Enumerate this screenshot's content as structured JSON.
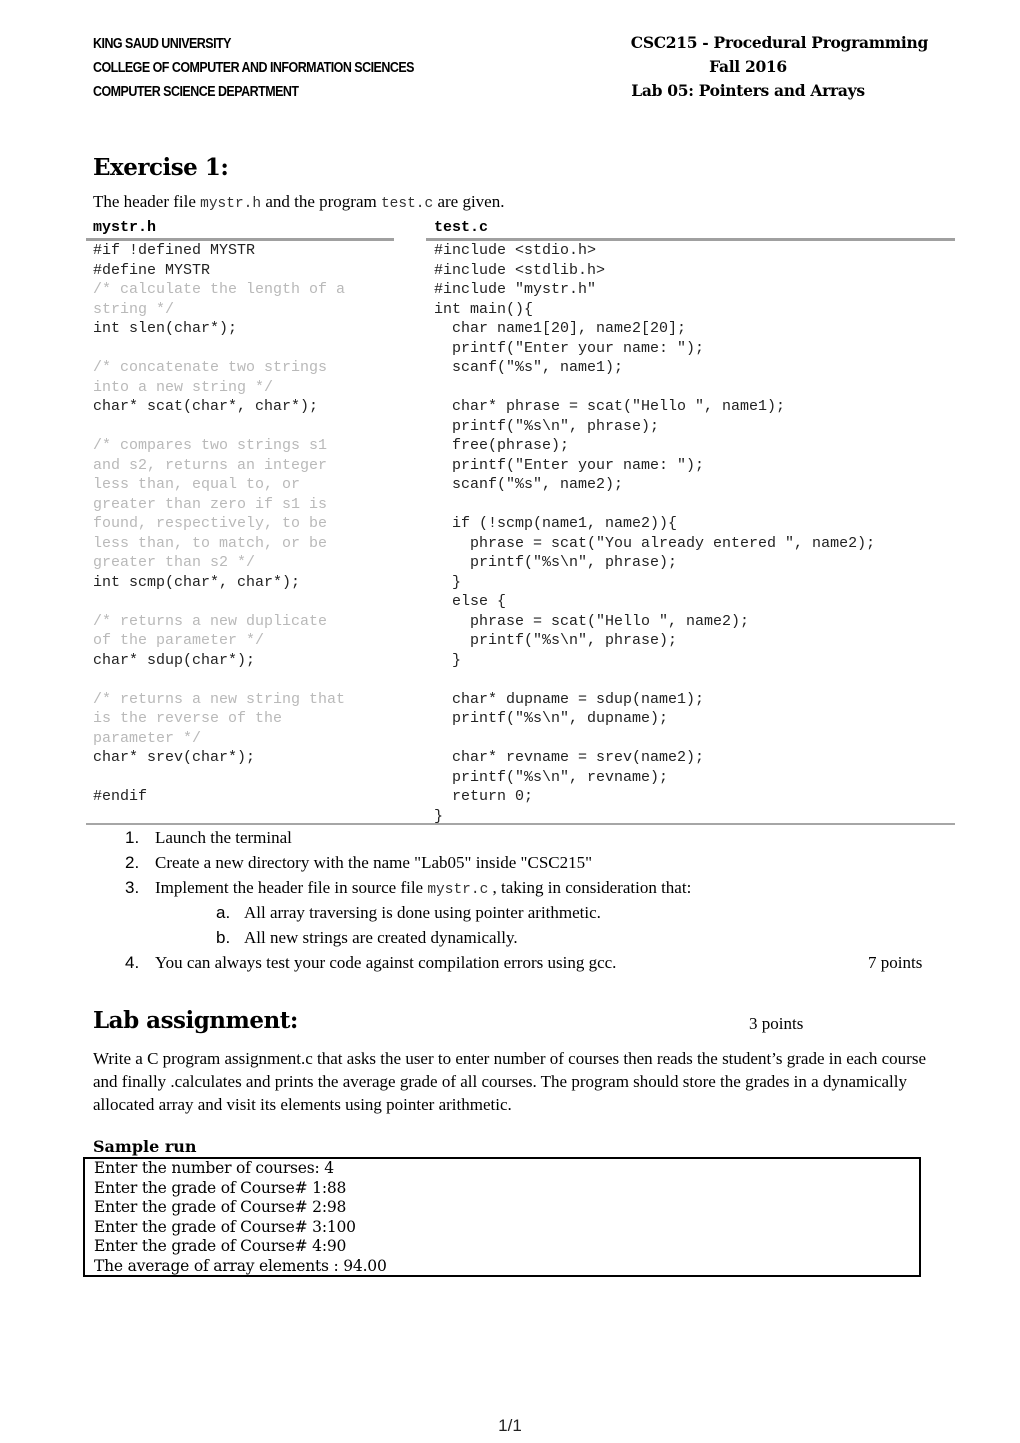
{
  "header": {
    "left": [
      "KING SAUD UNIVERSITY",
      "COLLEGE OF COMPUTER AND INFORMATION SCIENCES",
      "COMPUTER  SCIENCE DEPARTMENT"
    ],
    "right": [
      "CSC215 - Procedural Programming",
      "Fall 2016",
      "Lab 05: Pointers and Arrays"
    ]
  },
  "exercise": {
    "title": "Exercise 1:",
    "intro": {
      "part1": "The header file ",
      "file1": "mystr.h",
      "part2": " and the program ",
      "file2": "test.c",
      "part3": " are given."
    },
    "left_title": "mystr.h",
    "right_title": "test.c",
    "mystr_h": [
      {
        "t": "#if !defined MYSTR",
        "c": false
      },
      {
        "t": "#define MYSTR",
        "c": false
      },
      {
        "t": "/* calculate the length of a",
        "c": true
      },
      {
        "t": "string */",
        "c": true
      },
      {
        "t": "int slen(char*);",
        "c": false
      },
      {
        "t": "",
        "c": false
      },
      {
        "t": "/* concatenate two strings",
        "c": true
      },
      {
        "t": "into a new string */",
        "c": true
      },
      {
        "t": "char* scat(char*, char*);",
        "c": false
      },
      {
        "t": "",
        "c": false
      },
      {
        "t": "/* compares two strings s1",
        "c": true
      },
      {
        "t": "and s2, returns an integer",
        "c": true
      },
      {
        "t": "less than, equal to, or",
        "c": true
      },
      {
        "t": "greater than zero if s1 is",
        "c": true
      },
      {
        "t": "found, respectively, to be",
        "c": true
      },
      {
        "t": "less than, to match, or be",
        "c": true
      },
      {
        "t": "greater than s2 */",
        "c": true
      },
      {
        "t": "int scmp(char*, char*);",
        "c": false
      },
      {
        "t": "",
        "c": false
      },
      {
        "t": "/* returns a new duplicate",
        "c": true
      },
      {
        "t": "of the parameter */",
        "c": true
      },
      {
        "t": "char* sdup(char*);",
        "c": false
      },
      {
        "t": "",
        "c": false
      },
      {
        "t": "/* returns a new string that",
        "c": true
      },
      {
        "t": "is the reverse of the",
        "c": true
      },
      {
        "t": "parameter */",
        "c": true
      },
      {
        "t": "char* srev(char*);",
        "c": false
      },
      {
        "t": "",
        "c": false
      },
      {
        "t": "#endif",
        "c": false
      }
    ],
    "test_c": [
      "#include <stdio.h>",
      "#include <stdlib.h>",
      "#include \"mystr.h\"",
      "int main(){",
      "  char name1[20], name2[20];",
      "  printf(\"Enter your name: \");",
      "  scanf(\"%s\", name1);",
      "",
      "  char* phrase = scat(\"Hello \", name1);",
      "  printf(\"%s\\n\", phrase);",
      "  free(phrase);",
      "  printf(\"Enter your name: \");",
      "  scanf(\"%s\", name2);",
      "",
      "  if (!scmp(name1, name2)){",
      "    phrase = scat(\"You already entered \", name2);",
      "    printf(\"%s\\n\", phrase);",
      "  }",
      "  else {",
      "    phrase = scat(\"Hello \", name2);",
      "    printf(\"%s\\n\", phrase);",
      "  }",
      "",
      "  char* dupname = sdup(name1);",
      "  printf(\"%s\\n\", dupname);",
      "",
      "  char* revname = srev(name2);",
      "  printf(\"%s\\n\", revname);",
      "  return 0;",
      "}"
    ],
    "steps": [
      {
        "num": "1.",
        "text": "Launch the terminal"
      },
      {
        "num": "2.",
        "text": "Create a new directory with the name \"Lab05\" inside \"CSC215\""
      },
      {
        "num": "3.",
        "text_before": "Implement the header file in source file ",
        "code": "mystr.c",
        "text_after": " , taking in consideration that:"
      },
      {
        "num": "a.",
        "text": "All array traversing is done using pointer arithmetic."
      },
      {
        "num": "b.",
        "text": "All new strings are created dynamically."
      },
      {
        "num": "4.",
        "text": "You can always test your code against compilation errors using gcc."
      }
    ],
    "points": "7 points"
  },
  "assignment": {
    "title": "Lab assignment:",
    "points": "3 points",
    "paragraph": "Write a C program assignment.c that asks the user to enter number of courses then reads the student’s grade in each course and finally .calculates and prints  the average grade of all courses. The program should store the grades in a dynamically allocated array and visit its elements using pointer arithmetic.",
    "sample_title": "Sample run",
    "sample_lines": [
      "Enter the number of courses: 4",
      "Enter the grade of Course# 1:88",
      "Enter the grade of Course# 2:98",
      "Enter the grade of Course# 3:100",
      "Enter the grade of Course# 4:90",
      "The average of array elements : 94.00"
    ]
  },
  "footer": {
    "page": "1/1"
  }
}
